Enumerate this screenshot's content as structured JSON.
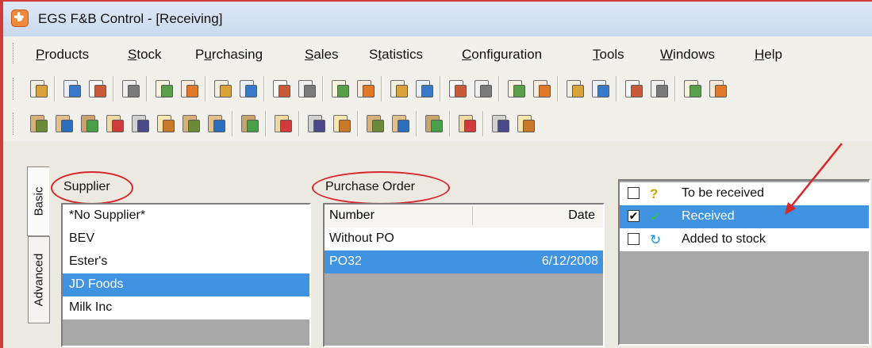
{
  "window": {
    "title": "EGS F&B Control - [Receiving]"
  },
  "menu": [
    {
      "pre": "",
      "u": "P",
      "post": "roducts"
    },
    {
      "pre": "",
      "u": "S",
      "post": "tock"
    },
    {
      "pre": "P",
      "u": "u",
      "post": "rchasing"
    },
    {
      "pre": "",
      "u": "S",
      "post": "ales"
    },
    {
      "pre": "S",
      "u": "t",
      "post": "atistics"
    },
    {
      "pre": "",
      "u": "C",
      "post": "onfiguration"
    },
    {
      "pre": "",
      "u": "T",
      "post": "ools"
    },
    {
      "pre": "",
      "u": "W",
      "post": "indows"
    },
    {
      "pre": "",
      "u": "H",
      "post": "elp"
    }
  ],
  "tabs": {
    "basic": "Basic",
    "advanced": "Advanced"
  },
  "supplier": {
    "label": "Supplier",
    "items": [
      "*No Supplier*",
      "BEV",
      "Ester's",
      "JD Foods",
      "Milk Inc"
    ],
    "selected_index": 3
  },
  "purchase_order": {
    "label": "Purchase Order",
    "columns": {
      "number": "Number",
      "date": "Date"
    },
    "rows": [
      {
        "number": "Without PO",
        "date": ""
      },
      {
        "number": "PO32",
        "date": "6/12/2008"
      }
    ],
    "selected_index": 1
  },
  "status": {
    "items": [
      {
        "label": "To be received",
        "checked": false,
        "icon": "question-icon"
      },
      {
        "label": "Received",
        "checked": true,
        "icon": "checkmark-icon"
      },
      {
        "label": "Added to stock",
        "checked": false,
        "icon": "refresh-arrow-icon"
      }
    ],
    "selected_index": 1
  },
  "colors": {
    "selection": "#3f93e0",
    "annotation": "#d9262b"
  }
}
